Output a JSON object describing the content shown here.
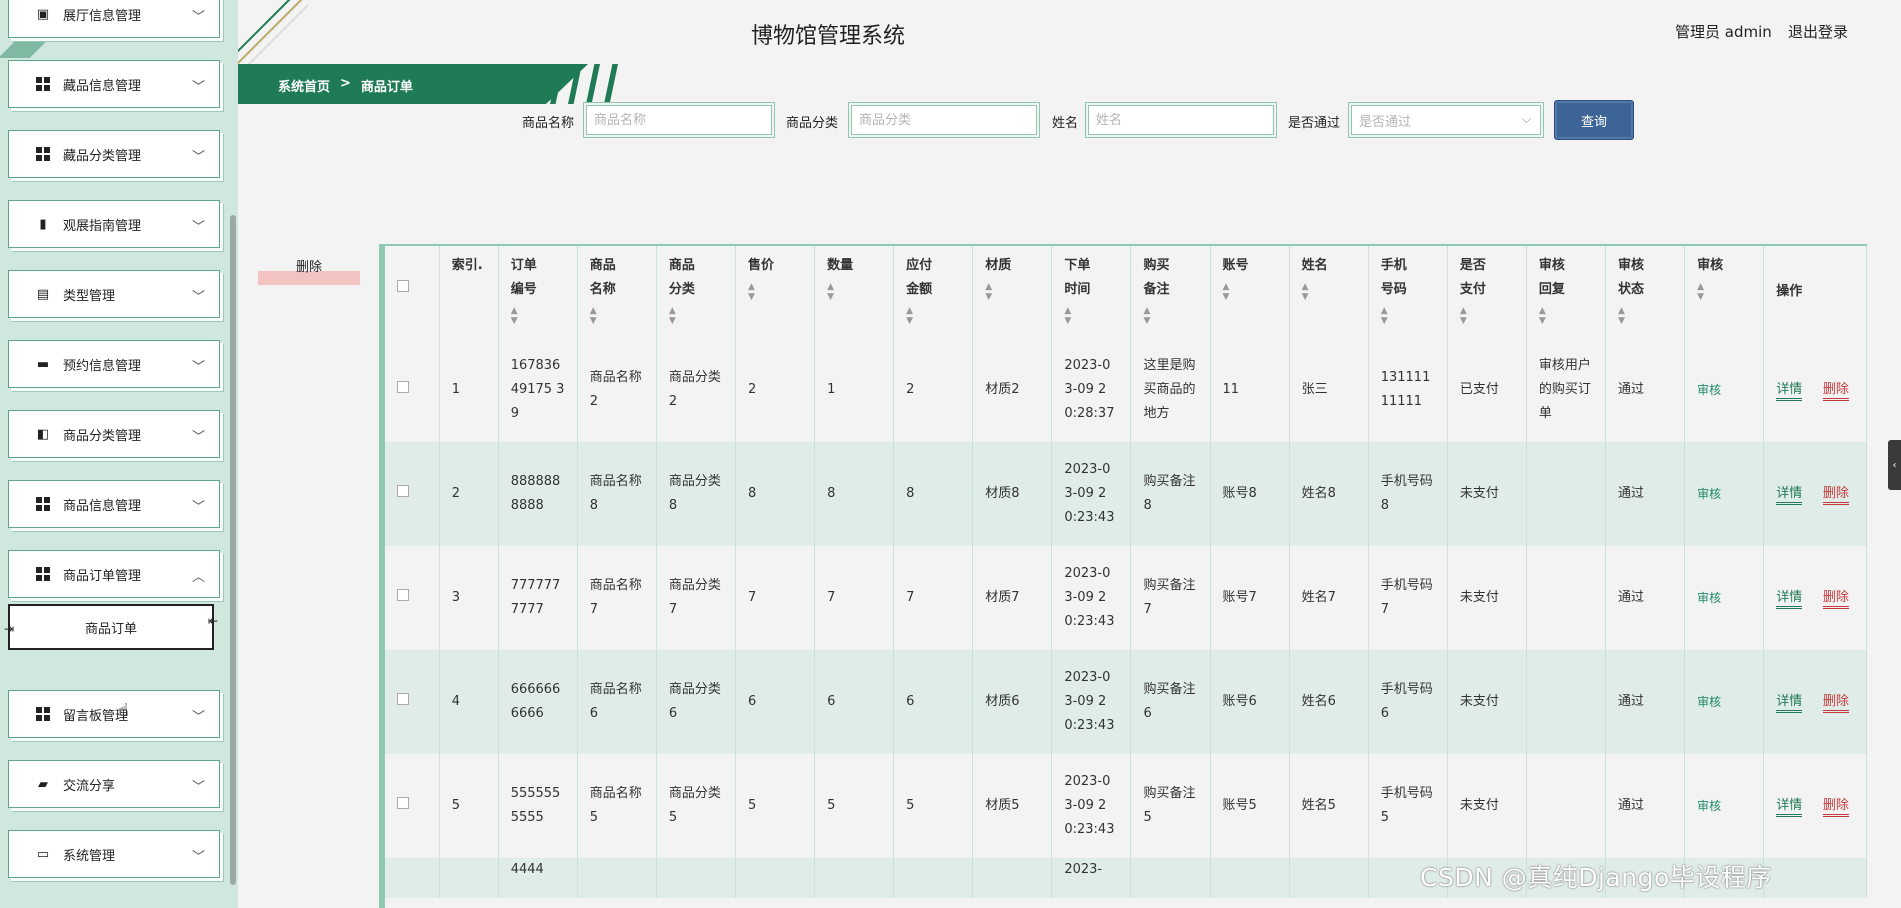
{
  "app_title": "博物馆管理系统",
  "user": {
    "role": "管理员 admin",
    "logout": "退出登录"
  },
  "breadcrumb": {
    "home": "系统首页",
    "sep": ">",
    "current": "商品订单"
  },
  "sidebar": {
    "items": [
      {
        "label": "展厅信息管理",
        "icon": "clipboard-x-icon"
      },
      {
        "label": "藏品信息管理",
        "icon": "grid-icon"
      },
      {
        "label": "藏品分类管理",
        "icon": "grid-icon"
      },
      {
        "label": "观展指南管理",
        "icon": "bar-chart-icon"
      },
      {
        "label": "类型管理",
        "icon": "clipboard-icon"
      },
      {
        "label": "预约信息管理",
        "icon": "chat-icon"
      },
      {
        "label": "商品分类管理",
        "icon": "wallet-icon"
      },
      {
        "label": "商品信息管理",
        "icon": "grid-icon"
      },
      {
        "label": "商品订单管理",
        "icon": "grid-icon",
        "expanded": true
      },
      {
        "label": "留言板管理",
        "icon": "grid-icon"
      },
      {
        "label": "交流分享",
        "icon": "monitor-icon"
      },
      {
        "label": "系统管理",
        "icon": "desktop-icon"
      }
    ],
    "sub_item": "商品订单"
  },
  "search": {
    "name_label": "商品名称",
    "name_placeholder": "商品名称",
    "category_label": "商品分类",
    "category_placeholder": "商品分类",
    "person_label": "姓名",
    "person_placeholder": "姓名",
    "approved_label": "是否通过",
    "approved_placeholder": "是否通过",
    "query": "查询"
  },
  "delete_label": "删除",
  "table": {
    "headers": [
      "索引.",
      "订单编号",
      "商品名称",
      "商品分类",
      "售价",
      "数量",
      "应付金额",
      "材质",
      "下单时间",
      "购买备注",
      "账号",
      "姓名",
      "手机号码",
      "是否支付",
      "审核回复",
      "审核状态",
      "审核",
      "操作"
    ],
    "rows": [
      {
        "idx": "1",
        "order": "16783649175 39",
        "name": "商品名称2",
        "category": "商品分类2",
        "price": "2",
        "qty": "1",
        "amount": "2",
        "material": "材质2",
        "time": "2023-03-09 20:28:37",
        "note": "这里是购买商品的地方",
        "account": "11",
        "person": "张三",
        "phone": "13111111111",
        "paid": "已支付",
        "reply": "审核用户的购买订单",
        "status": "通过",
        "audit": "审核",
        "detail": "详情",
        "del": "删除"
      },
      {
        "idx": "2",
        "order": "8888888888",
        "name": "商品名称8",
        "category": "商品分类8",
        "price": "8",
        "qty": "8",
        "amount": "8",
        "material": "材质8",
        "time": "2023-03-09 20:23:43",
        "note": "购买备注8",
        "account": "账号8",
        "person": "姓名8",
        "phone": "手机号码8",
        "paid": "未支付",
        "reply": "",
        "status": "通过",
        "audit": "审核",
        "detail": "详情",
        "del": "删除"
      },
      {
        "idx": "3",
        "order": "7777777777",
        "name": "商品名称7",
        "category": "商品分类7",
        "price": "7",
        "qty": "7",
        "amount": "7",
        "material": "材质7",
        "time": "2023-03-09 20:23:43",
        "note": "购买备注7",
        "account": "账号7",
        "person": "姓名7",
        "phone": "手机号码7",
        "paid": "未支付",
        "reply": "",
        "status": "通过",
        "audit": "审核",
        "detail": "详情",
        "del": "删除"
      },
      {
        "idx": "4",
        "order": "6666666666",
        "name": "商品名称6",
        "category": "商品分类6",
        "price": "6",
        "qty": "6",
        "amount": "6",
        "material": "材质6",
        "time": "2023-03-09 20:23:43",
        "note": "购买备注6",
        "account": "账号6",
        "person": "姓名6",
        "phone": "手机号码6",
        "paid": "未支付",
        "reply": "",
        "status": "通过",
        "audit": "审核",
        "detail": "详情",
        "del": "删除"
      },
      {
        "idx": "5",
        "order": "5555555555",
        "name": "商品名称5",
        "category": "商品分类5",
        "price": "5",
        "qty": "5",
        "amount": "5",
        "material": "材质5",
        "time": "2023-03-09 20:23:43",
        "note": "购买备注5",
        "account": "账号5",
        "person": "姓名5",
        "phone": "手机号码5",
        "paid": "未支付",
        "reply": "",
        "status": "通过",
        "audit": "审核",
        "detail": "详情",
        "del": "删除"
      },
      {
        "idx": "",
        "order": "4444",
        "name": "",
        "category": "",
        "price": "",
        "qty": "",
        "amount": "",
        "material": "",
        "time": "2023-",
        "note": "",
        "account": "",
        "person": "",
        "phone": "",
        "paid": "",
        "reply": "",
        "status": "",
        "audit": "",
        "detail": "",
        "del": ""
      }
    ]
  },
  "watermark": "CSDN @真纯Django毕设程序",
  "colors": {
    "brand_green": "#1f7a56",
    "query_blue": "#3d6496",
    "delete_red": "#c43a3a",
    "row_alt": "#e0ece7"
  }
}
